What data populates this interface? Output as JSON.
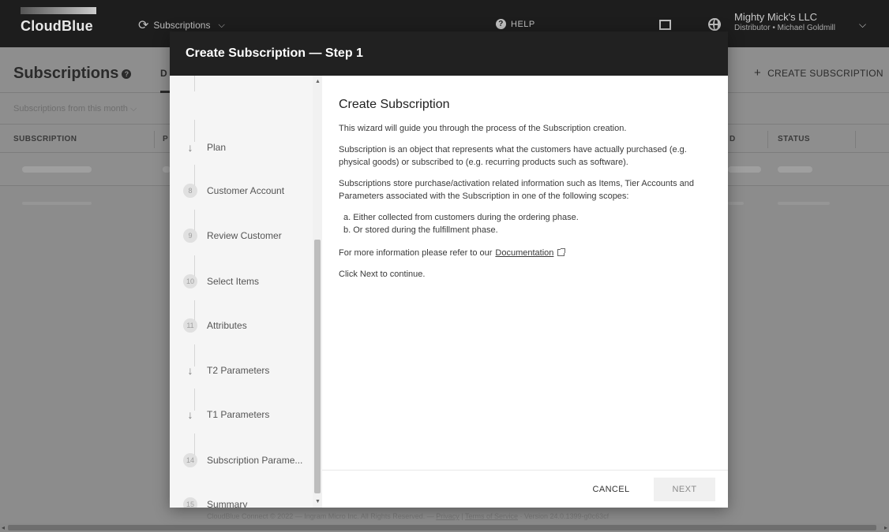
{
  "topbar": {
    "logo_text": "CloudBlue",
    "app_switcher_label": "Subscriptions",
    "help_label": "HELP",
    "account_name": "Mighty Mick's LLC",
    "account_sub": "Distributor • Michael Goldmill"
  },
  "page": {
    "title": "Subscriptions",
    "tab_partial": "D",
    "create_label": "CREATE SUBSCRIPTION",
    "filter_label": "Subscriptions from this month",
    "columns": [
      "SUBSCRIPTION",
      "P",
      "D",
      "STATUS"
    ]
  },
  "footer": {
    "prefix": "CloudBlue Connect © 2022 — Ingram Micro Inc. All Rights Reserved. — ",
    "privacy": "Privacy",
    "separator": " | ",
    "terms": "Terms of Service",
    "version": " · Version 24.0.1399-g0c63cf"
  },
  "modal": {
    "title": "Create Subscription — Step 1",
    "steps": [
      {
        "num": "",
        "label": "Plan",
        "kind": "arrow"
      },
      {
        "num": "8",
        "label": "Customer Account",
        "kind": "number"
      },
      {
        "num": "9",
        "label": "Review Customer",
        "kind": "number"
      },
      {
        "num": "10",
        "label": "Select Items",
        "kind": "number"
      },
      {
        "num": "11",
        "label": "Attributes",
        "kind": "number"
      },
      {
        "num": "",
        "label": "T2 Parameters",
        "kind": "arrow"
      },
      {
        "num": "",
        "label": "T1 Parameters",
        "kind": "arrow"
      },
      {
        "num": "14",
        "label": "Subscription Parame...",
        "kind": "number"
      },
      {
        "num": "15",
        "label": "Summary",
        "kind": "number"
      }
    ],
    "content": {
      "heading": "Create Subscription",
      "p1": "This wizard will guide you through the process of the Subscription creation.",
      "p2": "Subscription is an object that represents what the customers have actually purchased  (e.g. physical goods) or subscribed to  (e.g. recurring products such as software).",
      "p3": "Subscriptions store purchase/activation related information such as Items,  Tier Accounts and Parameters associated with the Subscription in one of   the following scopes:",
      "list_a": "a. Either collected from customers during the ordering phase.",
      "list_b": "b. Or stored during the fulfillment phase.",
      "p4_prefix": "For more information please refer to our",
      "doc_link": "Documentation",
      "p5": "Click Next to continue."
    },
    "cancel_label": "CANCEL",
    "next_label": "NEXT"
  }
}
